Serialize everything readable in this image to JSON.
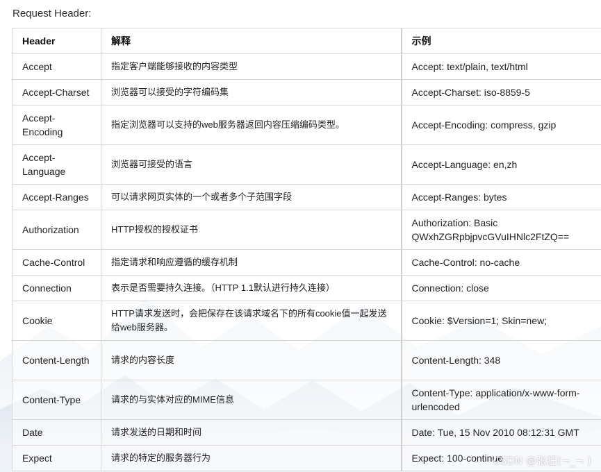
{
  "title": "Request Header:",
  "columns": {
    "header": "Header",
    "desc": "解释",
    "example": "示例"
  },
  "rows": [
    {
      "header": "Accept",
      "desc": "指定客户端能够接收的内容类型",
      "example": "Accept: text/plain, text/html"
    },
    {
      "header": "Accept-Charset",
      "desc": "浏览器可以接受的字符编码集",
      "example": "Accept-Charset: iso-8859-5"
    },
    {
      "header": "Accept-Encoding",
      "desc": "指定浏览器可以支持的web服务器返回内容压缩编码类型。",
      "example": "Accept-Encoding: compress, gzip"
    },
    {
      "header": "Accept-Language",
      "desc": "浏览器可接受的语言",
      "example": "Accept-Language: en,zh"
    },
    {
      "header": "Accept-Ranges",
      "desc": "可以请求网页实体的一个或者多个子范围字段",
      "example": "Accept-Ranges: bytes"
    },
    {
      "header": "Authorization",
      "desc": "HTTP授权的授权证书",
      "example": "Authorization: Basic QWxhZGRpbjpvcGVuIHNlc2FtZQ=="
    },
    {
      "header": "Cache-Control",
      "desc": "指定请求和响应遵循的缓存机制",
      "example": "Cache-Control: no-cache"
    },
    {
      "header": "Connection",
      "desc": "表示是否需要持久连接。（HTTP 1.1默认进行持久连接）",
      "example": "Connection: close"
    },
    {
      "header": "Cookie",
      "desc": "HTTP请求发送时，会把保存在该请求域名下的所有cookie值一起发送给web服务器。",
      "example": "Cookie: $Version=1; Skin=new;"
    },
    {
      "header": "Content-Length",
      "desc": "请求的内容长度",
      "example": "Content-Length: 348"
    },
    {
      "header": "Content-Type",
      "desc": "请求的与实体对应的MIME信息",
      "example": "Content-Type: application/x-www-form-urlencoded"
    },
    {
      "header": "Date",
      "desc": "请求发送的日期和时间",
      "example": "Date: Tue, 15 Nov 2010 08:12:31 GMT"
    },
    {
      "header": "Expect",
      "desc": "请求的特定的服务器行为",
      "example": "Expect: 100-continue"
    }
  ],
  "watermark": "CSDN @张狂(¬_¬ )"
}
